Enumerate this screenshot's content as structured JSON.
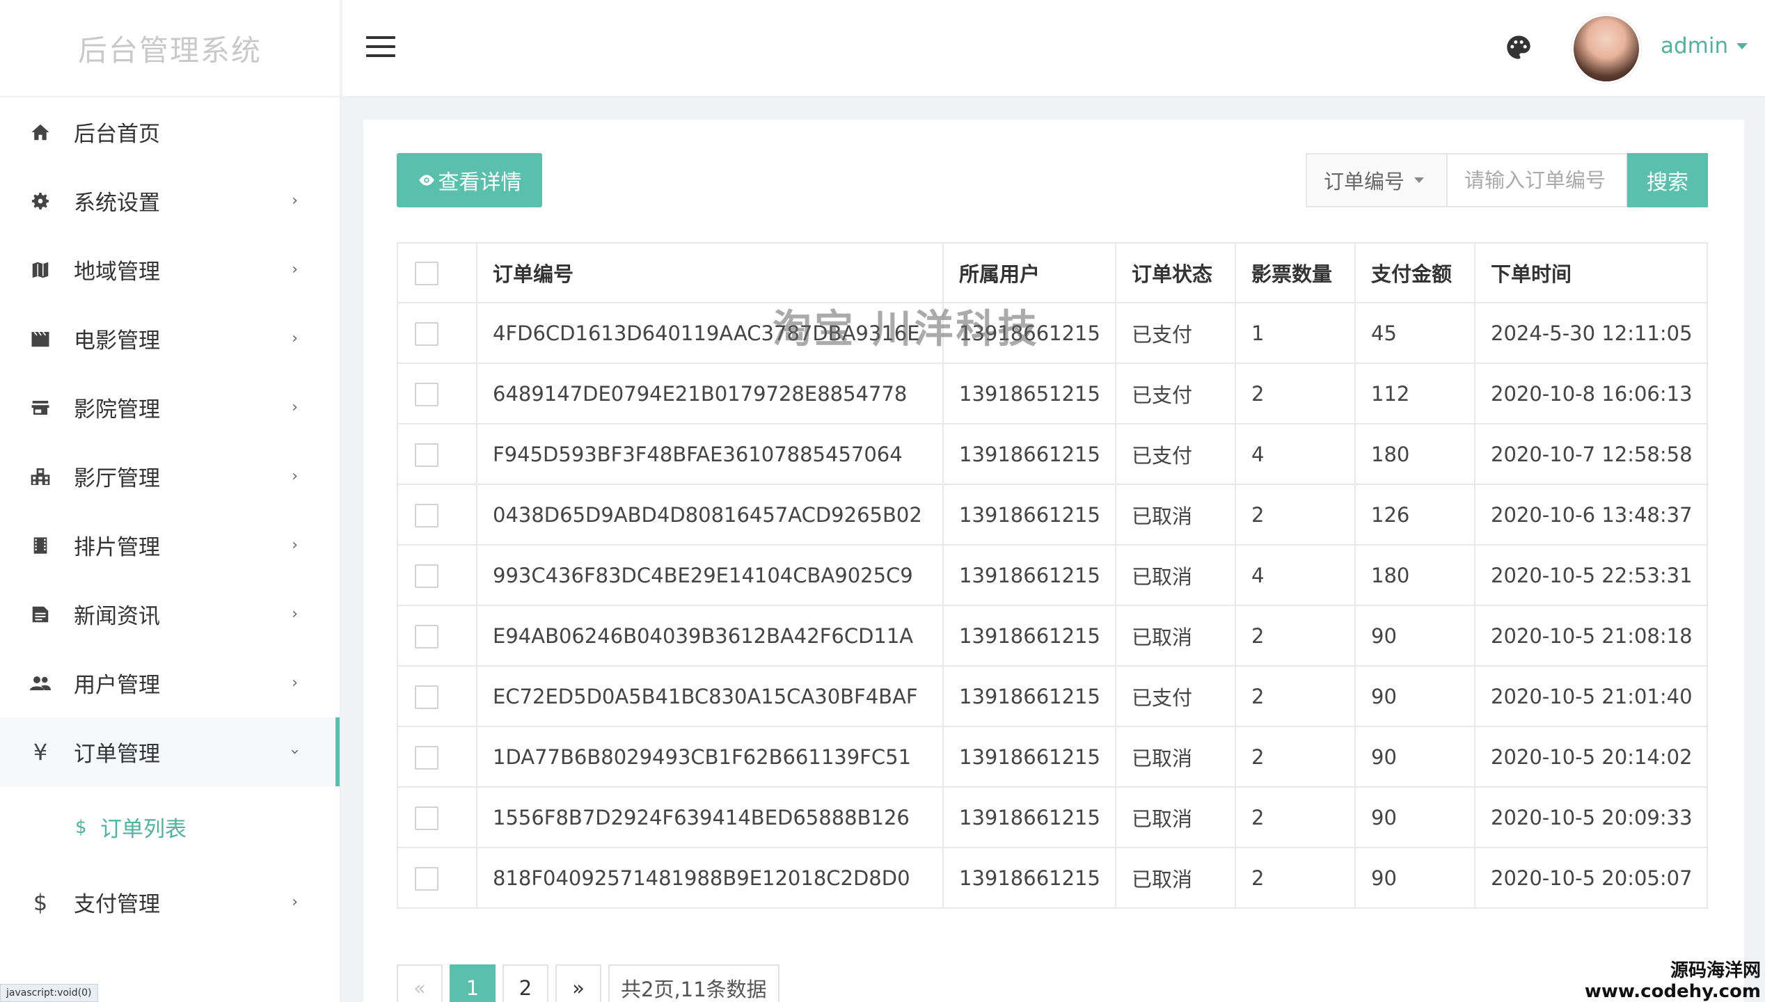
{
  "app": {
    "title": "后台管理系统"
  },
  "sidebar": {
    "items": [
      {
        "label": "后台首页",
        "icon": "home-icon"
      },
      {
        "label": "系统设置",
        "icon": "gear-icon",
        "arrow": "›"
      },
      {
        "label": "地域管理",
        "icon": "map-icon",
        "arrow": "›"
      },
      {
        "label": "电影管理",
        "icon": "clapperboard-icon",
        "arrow": "›"
      },
      {
        "label": "影院管理",
        "icon": "store-icon",
        "arrow": "›"
      },
      {
        "label": "影厅管理",
        "icon": "building-icon",
        "arrow": "›"
      },
      {
        "label": "排片管理",
        "icon": "film-strip-icon",
        "arrow": "›"
      },
      {
        "label": "新闻资讯",
        "icon": "document-icon",
        "arrow": "›"
      },
      {
        "label": "用户管理",
        "icon": "users-icon",
        "arrow": "›"
      },
      {
        "label": "订单管理",
        "icon": "yen-icon",
        "arrow": "›",
        "glyph": "¥"
      },
      {
        "label": "支付管理",
        "icon": "dollar-icon",
        "arrow": "›",
        "glyph": "$"
      }
    ],
    "sub_item": {
      "label": "订单列表",
      "glyph": "$"
    }
  },
  "header": {
    "user": "admin"
  },
  "toolbar": {
    "detail_label": "查看详情",
    "search_field": "订单编号",
    "search_placeholder": "请输入订单编号",
    "search_label": "搜索"
  },
  "table": {
    "columns": [
      "订单编号",
      "所属用户",
      "订单状态",
      "影票数量",
      "支付金额",
      "下单时间"
    ],
    "rows": [
      {
        "no": "4FD6CD1613D640119AAC3787DBA9316E",
        "user": "13918661215",
        "status": "已支付",
        "paid": true,
        "qty": "1",
        "amount": "45",
        "time": "2024-5-30 12:11:05"
      },
      {
        "no": "6489147DE0794E21B0179728E8854778",
        "user": "13918651215",
        "status": "已支付",
        "paid": true,
        "qty": "2",
        "amount": "112",
        "time": "2020-10-8 16:06:13"
      },
      {
        "no": "F945D593BF3F48BFAE36107885457064",
        "user": "13918661215",
        "status": "已支付",
        "paid": true,
        "qty": "4",
        "amount": "180",
        "time": "2020-10-7 12:58:58"
      },
      {
        "no": "0438D65D9ABD4D80816457ACD9265B02",
        "user": "13918661215",
        "status": "已取消",
        "paid": false,
        "qty": "2",
        "amount": "126",
        "time": "2020-10-6 13:48:37"
      },
      {
        "no": "993C436F83DC4BE29E14104CBA9025C9",
        "user": "13918661215",
        "status": "已取消",
        "paid": false,
        "qty": "4",
        "amount": "180",
        "time": "2020-10-5 22:53:31"
      },
      {
        "no": "E94AB06246B04039B3612BA42F6CD11A",
        "user": "13918661215",
        "status": "已取消",
        "paid": false,
        "qty": "2",
        "amount": "90",
        "time": "2020-10-5 21:08:18"
      },
      {
        "no": "EC72ED5D0A5B41BC830A15CA30BF4BAF",
        "user": "13918661215",
        "status": "已支付",
        "paid": true,
        "qty": "2",
        "amount": "90",
        "time": "2020-10-5 21:01:40"
      },
      {
        "no": "1DA77B6B8029493CB1F62B661139FC51",
        "user": "13918661215",
        "status": "已取消",
        "paid": false,
        "qty": "2",
        "amount": "90",
        "time": "2020-10-5 20:14:02"
      },
      {
        "no": "1556F8B7D2924F639414BED65888B126",
        "user": "13918661215",
        "status": "已取消",
        "paid": false,
        "qty": "2",
        "amount": "90",
        "time": "2020-10-5 20:09:33"
      },
      {
        "no": "818F04092571481988B9E12018C2D8D0",
        "user": "13918661215",
        "status": "已取消",
        "paid": false,
        "qty": "2",
        "amount": "90",
        "time": "2020-10-5 20:05:07"
      }
    ]
  },
  "pagination": {
    "prev": "«",
    "pages": [
      "1",
      "2"
    ],
    "current": "1",
    "next": "»",
    "info": "共2页,11条数据"
  },
  "watermark": "淘宝 川洋科技",
  "statusbar": "javascript:void(0)",
  "corner_mark": {
    "line1": "源码海洋网",
    "line2": "www.codehy.com"
  },
  "colors": {
    "accent": "#5bbfad",
    "accent_text": "#4fb39f",
    "cancelled": "#d9d9d9"
  }
}
